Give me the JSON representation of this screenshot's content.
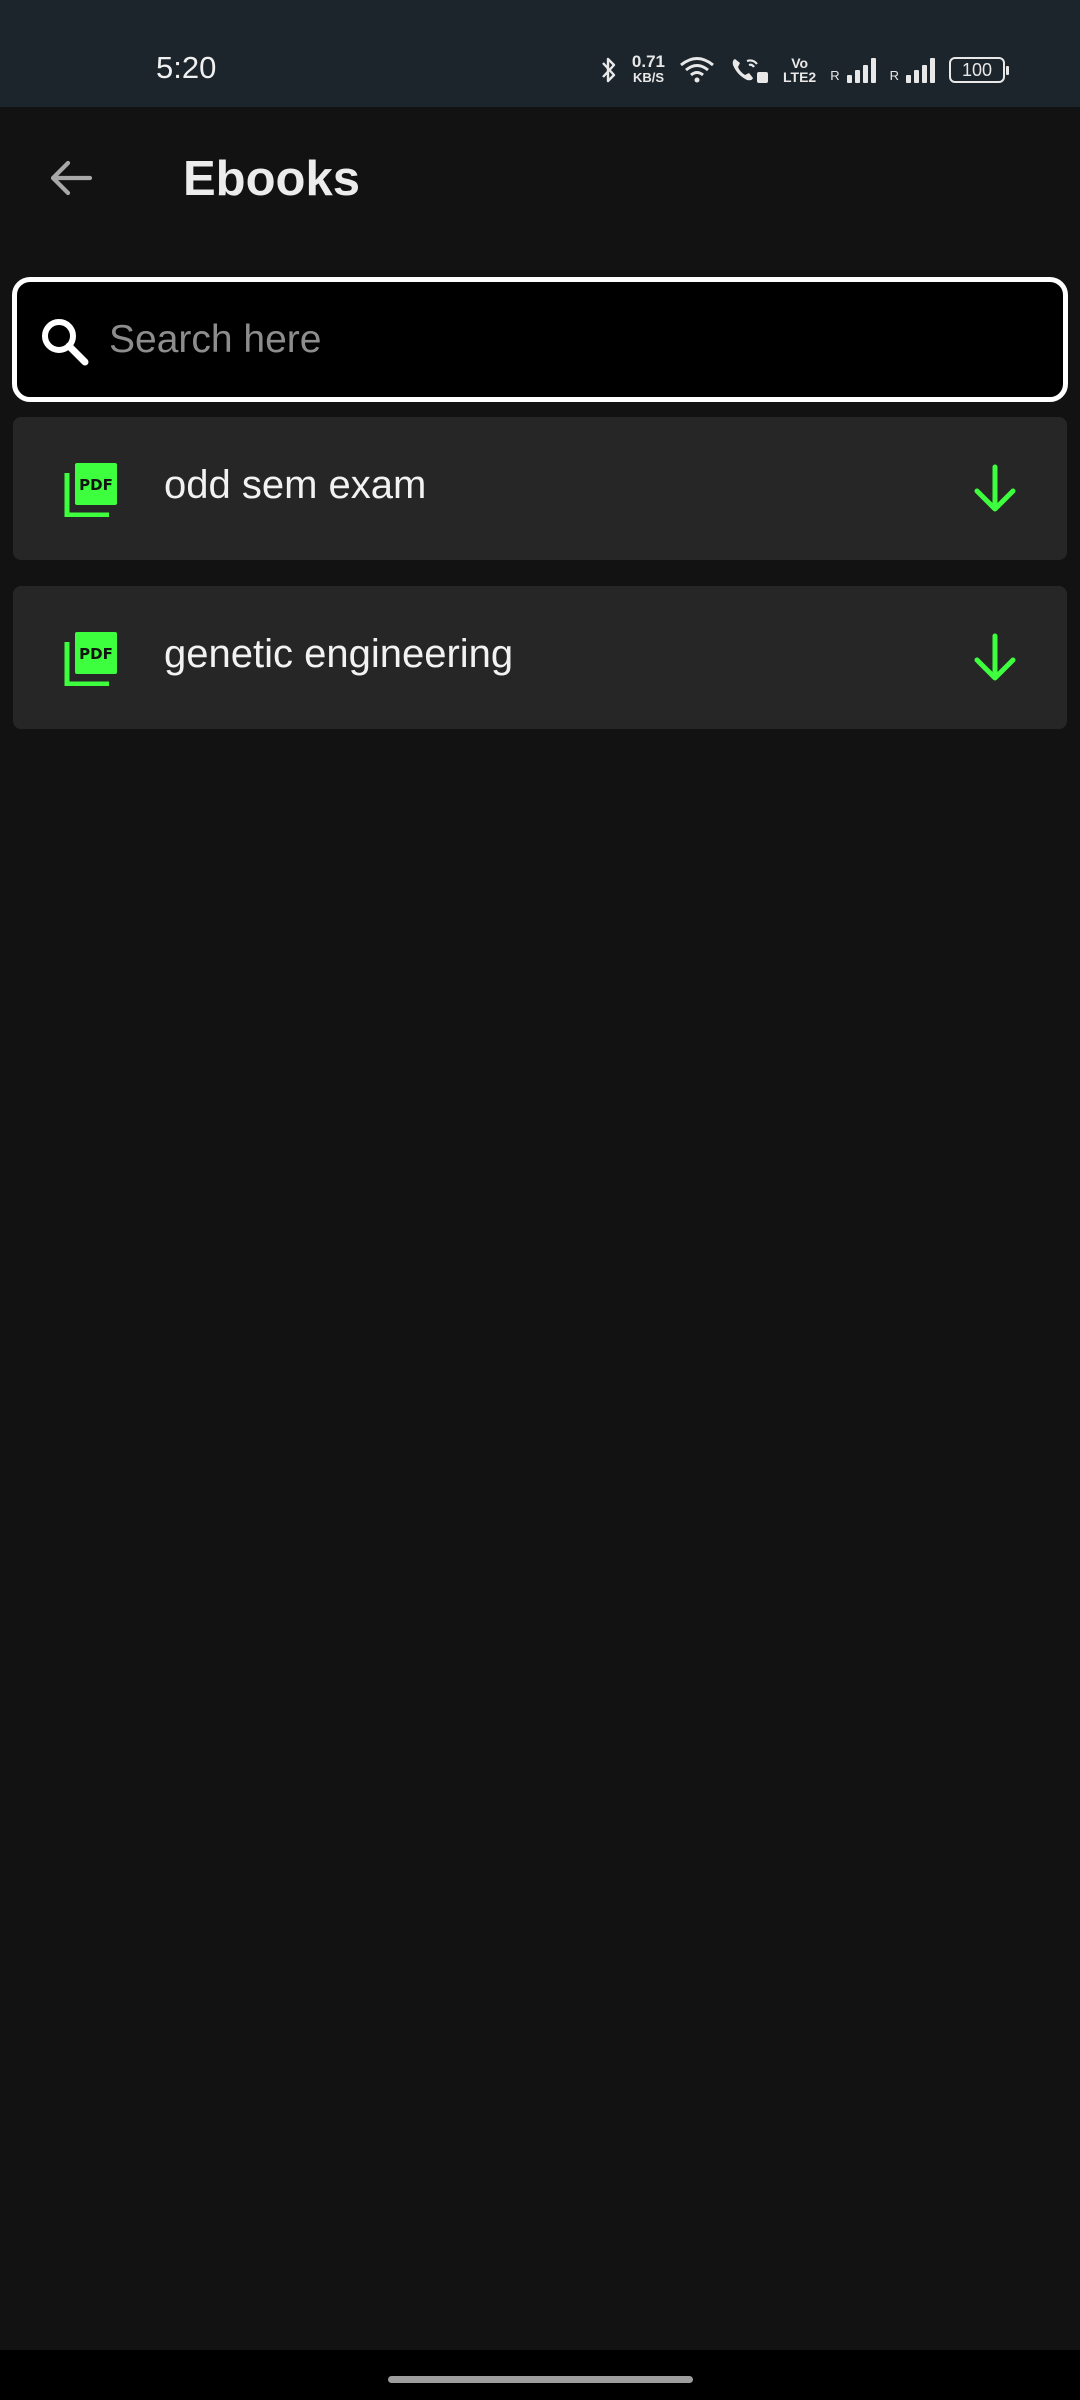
{
  "status_bar": {
    "time": "5:20",
    "net_speed": "0.71",
    "net_speed_unit": "KB/S",
    "volte_top": "Vo",
    "volte_bottom": "LTE2",
    "roaming_1": "R",
    "roaming_2": "R",
    "battery": "100",
    "icons": [
      "bluetooth-icon",
      "wifi-icon",
      "wifi-calling-icon",
      "signal-icon",
      "signal-icon",
      "battery-icon"
    ]
  },
  "app_bar": {
    "title": "Ebooks",
    "back_icon": "arrow-back-icon"
  },
  "search": {
    "placeholder": "Search here",
    "value": "",
    "icon": "search-icon"
  },
  "ebooks": [
    {
      "title": "odd sem exam",
      "icon": "pdf-icon",
      "action_icon": "download-icon"
    },
    {
      "title": "genetic engineering",
      "icon": "pdf-icon",
      "action_icon": "download-icon"
    }
  ],
  "colors": {
    "accent": "#3dff3d",
    "background": "#121212",
    "card": "#262626",
    "status_bar": "#1c252c"
  }
}
